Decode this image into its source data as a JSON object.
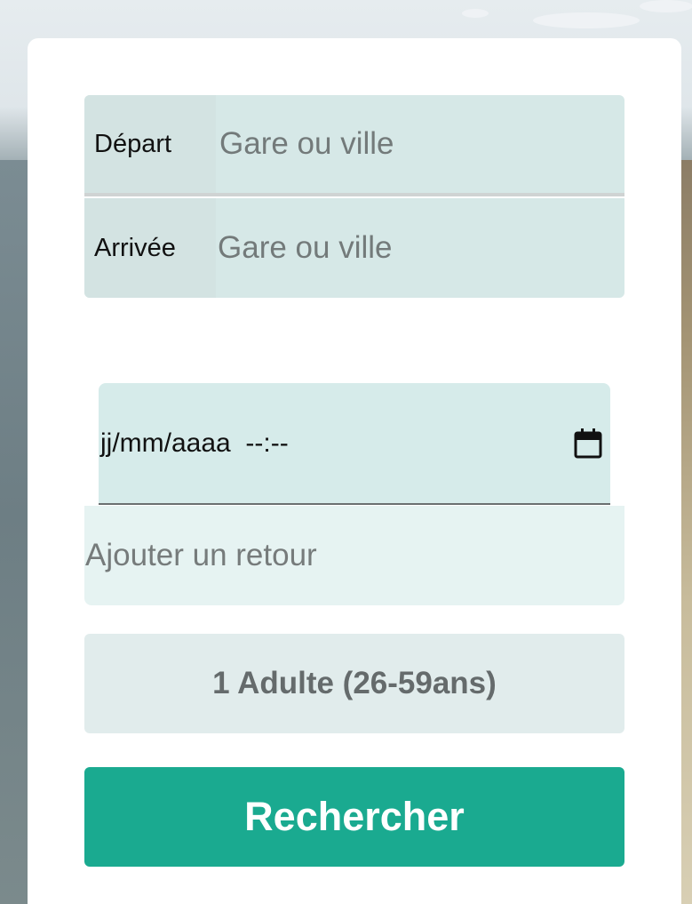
{
  "form": {
    "departure": {
      "label": "Départ",
      "placeholder": "Gare ou ville"
    },
    "arrival": {
      "label": "Arrivée",
      "placeholder": "Gare ou ville"
    },
    "datetime": {
      "value": "jj/mm/aaaa  --:--",
      "icon": "calendar-icon"
    },
    "return": {
      "label": "Ajouter un retour"
    },
    "passengers": {
      "label": "1 Adulte (26-59ans)"
    },
    "search": {
      "label": "Rechercher"
    }
  },
  "colors": {
    "accent": "#1aaa90",
    "field_bg": "#d6e8e7"
  }
}
